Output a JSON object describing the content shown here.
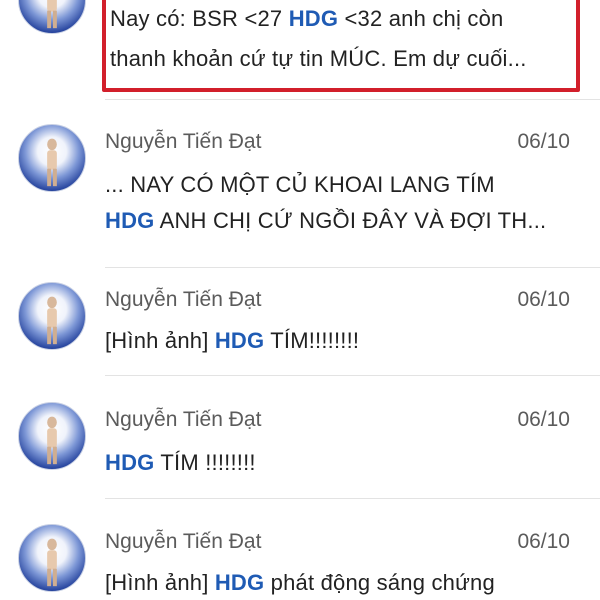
{
  "conversations": [
    {
      "name": "",
      "date": "",
      "line1_parts": [
        "Nay có: BSR <27 ",
        "HDG",
        " <32 anh chị còn"
      ],
      "line2": "thanh khoản cứ tự tin MÚC. Em dự cuối..."
    },
    {
      "name": "Nguyễn Tiến Đạt",
      "date": "06/10",
      "line1": "... NAY CÓ MỘT CỦ KHOAI LANG TÍM",
      "line2_parts": [
        "HDG",
        " ANH CHỊ CỨ NGỒI ĐÂY VÀ ĐỢI TH..."
      ]
    },
    {
      "name": "Nguyễn Tiến Đạt",
      "date": "06/10",
      "line1_parts": [
        "[Hình ảnh] ",
        "HDG",
        " TÍM!!!!!!!!"
      ]
    },
    {
      "name": "Nguyễn Tiến Đạt",
      "date": "06/10",
      "line1_parts": [
        "",
        "HDG",
        " TÍM !!!!!!!!"
      ]
    },
    {
      "name": "Nguyễn Tiến Đạt",
      "date": "06/10",
      "line1_parts": [
        "[Hình ảnh] ",
        "HDG",
        " phát động sáng chứng"
      ]
    }
  ],
  "colors": {
    "keyword": "#1f5bb4",
    "highlight_border": "#d21f2b"
  },
  "icons": {
    "avatar": "user-avatar-icon"
  }
}
